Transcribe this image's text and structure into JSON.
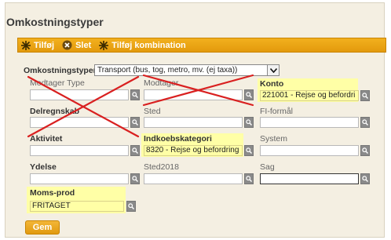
{
  "title": "Omkostningstyper",
  "toolbar": {
    "add_label": "Tilføj",
    "delete_label": "Slet",
    "add_combination_label": "Tilføj kombination"
  },
  "type_label": "Omkostningstyper*",
  "type_value": "Transport (bus, tog, metro, mv. (ej taxa))",
  "fields": {
    "modtager_type": {
      "label": "Modtager Type",
      "value": ""
    },
    "modtager": {
      "label": "Modtager",
      "value": ""
    },
    "konto": {
      "label": "Konto",
      "value": "221001 - Rejse og befordri"
    },
    "delregnskab": {
      "label": "Delregnskab",
      "value": ""
    },
    "sted": {
      "label": "Sted",
      "value": ""
    },
    "fi_formal": {
      "label": "FI-formål",
      "value": ""
    },
    "aktivitet": {
      "label": "Aktivitet",
      "value": ""
    },
    "indkoebskategori": {
      "label": "Indkoebskategori",
      "value": "8320 - Rejse og befordring"
    },
    "system": {
      "label": "System",
      "value": ""
    },
    "ydelse": {
      "label": "Ydelse",
      "value": ""
    },
    "sted2018": {
      "label": "Sted2018",
      "value": ""
    },
    "sag": {
      "label": "Sag",
      "value": ""
    },
    "moms_prod": {
      "label": "Moms-prod",
      "value": "FRITAGET"
    }
  },
  "save_label": "Gem",
  "colors": {
    "toolbar": "#e8a214",
    "highlight": "#ffffa6",
    "cross": "#d92020",
    "panel": "#f4efe2"
  }
}
